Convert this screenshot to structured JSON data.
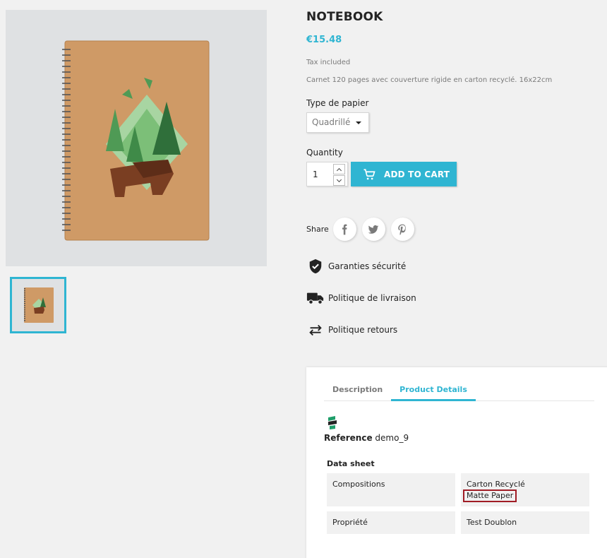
{
  "product": {
    "title": "NOTEBOOK",
    "price": "€15.48",
    "tax_note": "Tax included",
    "short_description": "Carnet 120 pages avec couverture rigide en carton recyclé. 16x22cm"
  },
  "variant": {
    "label": "Type de papier",
    "selected": "Quadrillé"
  },
  "quantity": {
    "label": "Quantity",
    "value": "1"
  },
  "add_to_cart_label": "ADD TO CART",
  "share": {
    "label": "Share",
    "networks": [
      "facebook-icon",
      "twitter-icon",
      "pinterest-icon"
    ]
  },
  "reassurance": [
    {
      "icon": "shield-check-icon",
      "label": "Garanties sécurité"
    },
    {
      "icon": "truck-icon",
      "label": "Politique de livraison"
    },
    {
      "icon": "exchange-arrows-icon",
      "label": "Politique retours"
    }
  ],
  "tabs": [
    {
      "label": "Description",
      "active": false
    },
    {
      "label": "Product Details",
      "active": true
    }
  ],
  "details": {
    "reference_label": "Reference",
    "reference_value": "demo_9",
    "data_sheet_title": "Data sheet",
    "rows": [
      {
        "name": "Compositions",
        "values": [
          "Carton Recyclé",
          "Matte Paper"
        ]
      },
      {
        "name": "Propriété",
        "values": [
          "Test Doublon"
        ]
      }
    ]
  },
  "colors": {
    "accent": "#2fb5d2",
    "highlight_border": "#a01c25"
  }
}
